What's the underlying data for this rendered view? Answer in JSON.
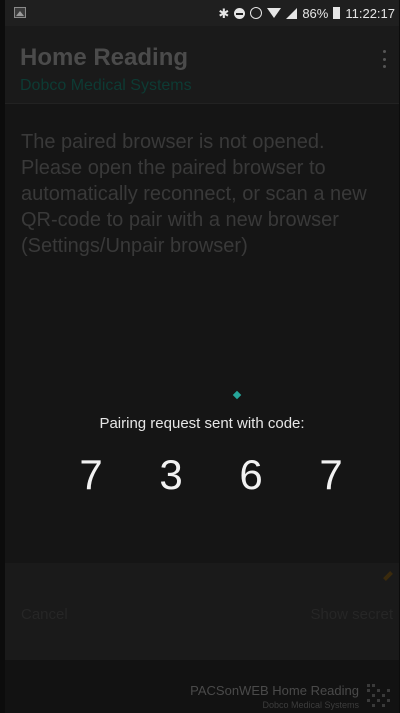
{
  "status_bar": {
    "battery_percent": "86%",
    "time": "11:22:17",
    "icons": [
      "gallery-icon",
      "bluetooth-icon",
      "do-not-disturb-icon",
      "alarm-icon",
      "wifi-icon",
      "signal-icon",
      "battery-icon"
    ]
  },
  "app_bar": {
    "title": "Home Reading",
    "subtitle": "Dobco Medical Systems",
    "menu_icon": "overflow-menu-icon"
  },
  "message": "The paired browser is not opened. Please open the paired browser to automatically reconnect, or scan a new QR-code to pair with a new browser (Settings/Unpair browser)",
  "pairing": {
    "label": "Pairing request sent with code:",
    "code": [
      "7",
      "3",
      "6",
      "7"
    ]
  },
  "actions": {
    "cancel_label": "Cancel",
    "show_secret_label": "Show secret"
  },
  "footer": {
    "title": "PACSonWEB Home Reading",
    "subtitle": "Dobco Medical Systems"
  },
  "colors": {
    "accent": "#26a69a",
    "text_primary": "#f2f2f2",
    "background": "#151515"
  }
}
